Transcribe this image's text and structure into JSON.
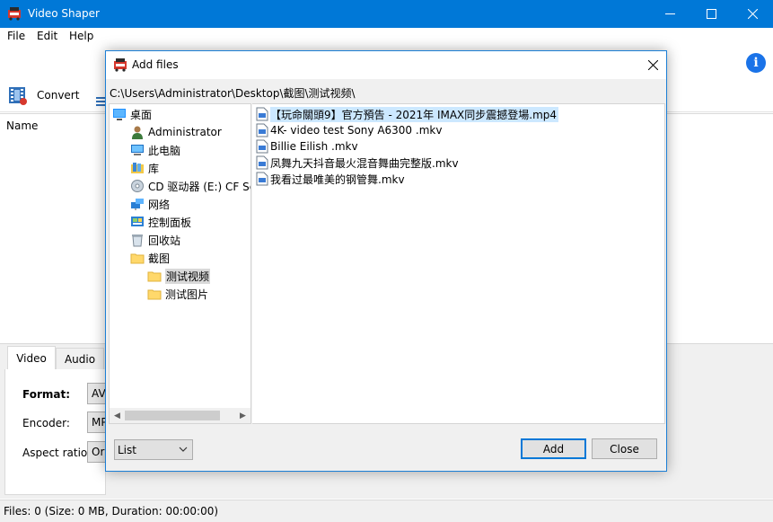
{
  "app": {
    "title": "Video Shaper",
    "menu": [
      "File",
      "Edit",
      "Help"
    ],
    "toolbar": {
      "convert_label": "Convert"
    },
    "list": {
      "name_header": "Name"
    },
    "tabs": [
      "Video",
      "Audio"
    ],
    "fields": [
      {
        "label": "Format:",
        "value": "AV"
      },
      {
        "label": "Encoder:",
        "value": "MP"
      },
      {
        "label": "Aspect ratio:",
        "value": "Or"
      }
    ],
    "status": "Files: 0 (Size: 0 MB, Duration: 00:00:00)"
  },
  "dialog": {
    "title": "Add files",
    "path": "C:\\Users\\Administrator\\Desktop\\截图\\测试视频\\",
    "tree": [
      {
        "label": "桌面",
        "icon": "desktop-icon"
      },
      {
        "label": "Administrator",
        "icon": "user-icon"
      },
      {
        "label": "此电脑",
        "icon": "computer-icon"
      },
      {
        "label": "库",
        "icon": "library-icon"
      },
      {
        "label": "CD 驱动器 (E:) CF Se",
        "icon": "cd-drive-icon"
      },
      {
        "label": "网络",
        "icon": "network-icon"
      },
      {
        "label": "控制面板",
        "icon": "control-panel-icon"
      },
      {
        "label": "回收站",
        "icon": "recycle-bin-icon"
      },
      {
        "label": "截图",
        "icon": "folder-icon"
      },
      {
        "label": "测试视频",
        "icon": "folder-icon",
        "selected": true
      },
      {
        "label": "测试图片",
        "icon": "folder-icon"
      }
    ],
    "files": [
      {
        "name": "【玩命關頭9】官方預告 - 2021年 IMAX同步震撼登場.mp4",
        "selected": true
      },
      {
        "name": "4K- video test Sony A6300 .mkv"
      },
      {
        "name": "Billie Eilish .mkv"
      },
      {
        "name": "凤舞九天抖音最火混音舞曲完整版.mkv"
      },
      {
        "name": "我看过最唯美的钢管舞.mkv"
      }
    ],
    "view_mode": "List",
    "add_label": "Add",
    "close_label": "Close"
  },
  "colors": {
    "titlebar": "#0078d7",
    "selection": "#cce8ff",
    "info": "#1a73e8"
  }
}
